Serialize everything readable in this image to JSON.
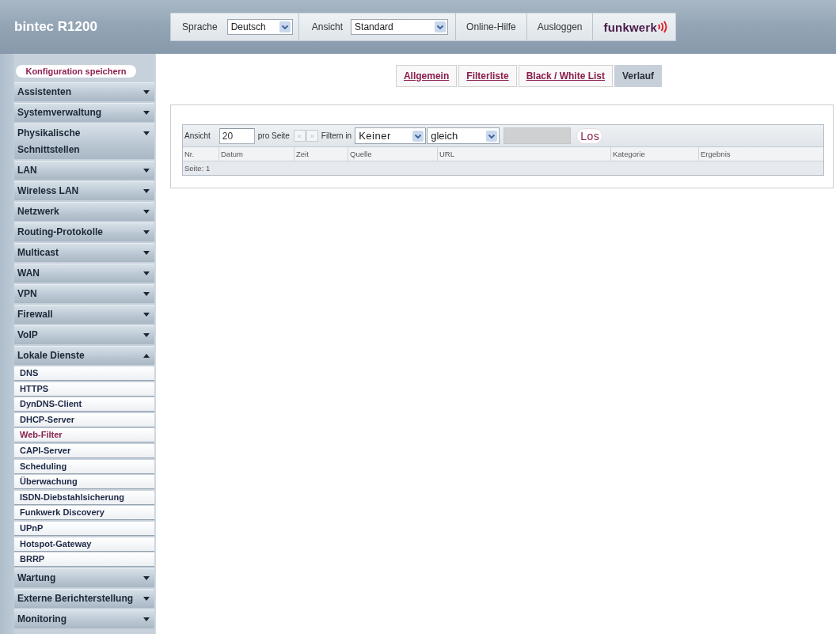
{
  "header": {
    "product": "bintec R1200",
    "language": {
      "label": "Sprache",
      "value": "Deutsch"
    },
    "view": {
      "label": "Ansicht",
      "value": "Standard"
    },
    "links": [
      "Online-Hilfe",
      "Ausloggen"
    ],
    "logo": "funkwerk"
  },
  "sidebar": {
    "save_button": "Konfiguration speichern",
    "items": [
      {
        "label": "Assistenten",
        "expanded": false
      },
      {
        "label": "Systemverwaltung",
        "expanded": false
      },
      {
        "label": "Physikalische Schnittstellen",
        "expanded": false
      },
      {
        "label": "LAN",
        "expanded": false
      },
      {
        "label": "Wireless LAN",
        "expanded": false
      },
      {
        "label": "Netzwerk",
        "expanded": false
      },
      {
        "label": "Routing-Protokolle",
        "expanded": false
      },
      {
        "label": "Multicast",
        "expanded": false
      },
      {
        "label": "WAN",
        "expanded": false
      },
      {
        "label": "VPN",
        "expanded": false
      },
      {
        "label": "Firewall",
        "expanded": false
      },
      {
        "label": "VoIP",
        "expanded": false
      },
      {
        "label": "Lokale Dienste",
        "expanded": true,
        "children": [
          {
            "label": "DNS",
            "selected": false
          },
          {
            "label": "HTTPS",
            "selected": false
          },
          {
            "label": "DynDNS-Client",
            "selected": false
          },
          {
            "label": "DHCP-Server",
            "selected": false
          },
          {
            "label": "Web-Filter",
            "selected": true
          },
          {
            "label": "CAPI-Server",
            "selected": false
          },
          {
            "label": "Scheduling",
            "selected": false
          },
          {
            "label": "Überwachung",
            "selected": false
          },
          {
            "label": "ISDN-Diebstahlsicherung",
            "selected": false
          },
          {
            "label": "Funkwerk Discovery",
            "selected": false
          },
          {
            "label": "UPnP",
            "selected": false
          },
          {
            "label": "Hotspot-Gateway",
            "selected": false
          },
          {
            "label": "BRRP",
            "selected": false
          }
        ]
      },
      {
        "label": "Wartung",
        "expanded": false
      },
      {
        "label": "Externe Berichterstellung",
        "expanded": false
      },
      {
        "label": "Monitoring",
        "expanded": false
      }
    ]
  },
  "tabs": [
    {
      "label": "Allgemein",
      "selected": false
    },
    {
      "label": "Filterliste",
      "selected": false
    },
    {
      "label": "Black / White List",
      "selected": false
    },
    {
      "label": "Verlauf",
      "selected": true
    }
  ],
  "filter_bar": {
    "view_label": "Ansicht",
    "per_page": "20",
    "per_page_label": "pro Seite",
    "pager": [
      {
        "label": "«",
        "disabled": true
      },
      {
        "label": "»",
        "disabled": true
      }
    ],
    "filter_label": "Filtern in",
    "field": "Keiner",
    "operator": "gleich",
    "search": {
      "disabled": true
    },
    "go_button": "Los"
  },
  "table": {
    "columns": [
      "Nr.",
      "Datum",
      "Zeit",
      "Quelle",
      "URL",
      "Kategorie",
      "Ergebnis"
    ],
    "footer": "Seite: 1"
  }
}
